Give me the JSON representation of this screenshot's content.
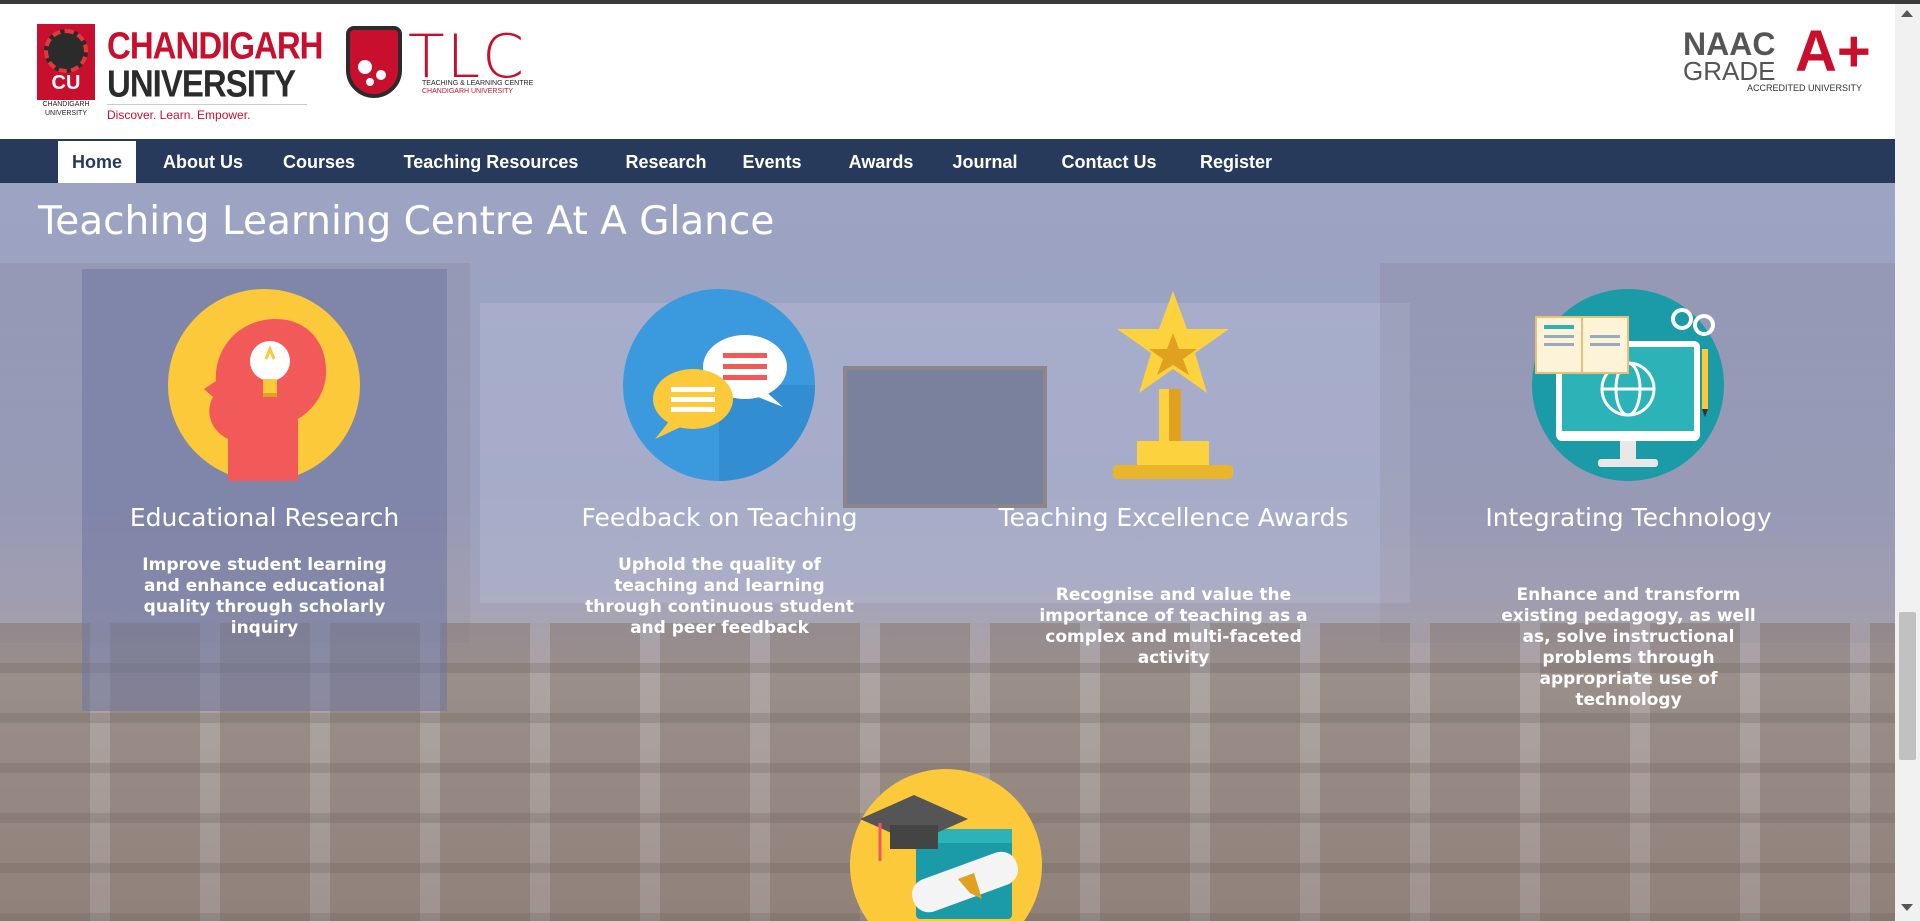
{
  "header": {
    "cu_logo": {
      "name_line1": "CHANDIGARH",
      "name_line2": "UNIVERSITY",
      "badge_text": "CU",
      "badge_sub": "CHANDIGARH UNIVERSITY",
      "tagline": "Discover. Learn. Empower."
    },
    "tlc_logo": {
      "title": "TLC",
      "sub1": "TEACHING & LEARNING CENTRE",
      "sub2": "CHANDIGARH UNIVERSITY"
    },
    "naac": {
      "line1": "NAAC",
      "line2": "GRADE",
      "grade": "A+",
      "accredited": "ACCREDITED UNIVERSITY"
    }
  },
  "nav": {
    "items": [
      {
        "label": "Home",
        "active": true
      },
      {
        "label": "About Us"
      },
      {
        "label": "Courses"
      },
      {
        "label": "Teaching Resources"
      },
      {
        "label": "Research"
      },
      {
        "label": "Events"
      },
      {
        "label": "Awards"
      },
      {
        "label": "Journal"
      },
      {
        "label": "Contact Us"
      },
      {
        "label": "Register"
      }
    ]
  },
  "section": {
    "title": "Teaching Learning Centre At A Glance",
    "cards": [
      {
        "title": "Educational Research",
        "desc": "Improve student learning and enhance educational quality through scholarly inquiry",
        "icon": "head-lightbulb-icon"
      },
      {
        "title": "Feedback on Teaching",
        "desc": "Uphold the quality of teaching and learning through continuous student and peer feedback",
        "icon": "chat-bubbles-icon"
      },
      {
        "title": "Teaching Excellence Awards",
        "desc": "Recognise and value the importance of teaching as a complex and multi-faceted activity",
        "icon": "trophy-star-icon"
      },
      {
        "title": "Integrating Technology",
        "desc": "Enhance and transform existing pedagogy, as well as, solve instructional problems through appropriate use of technology",
        "icon": "computer-book-icon"
      }
    ],
    "next_icon": "graduation-cap-diploma-icon"
  },
  "colors": {
    "brand_red": "#c8102e",
    "nav_bg": "#283a5b",
    "icon_yellow": "#fcc93a",
    "icon_blue": "#3b9ade",
    "icon_teal": "#1b9aa8"
  }
}
